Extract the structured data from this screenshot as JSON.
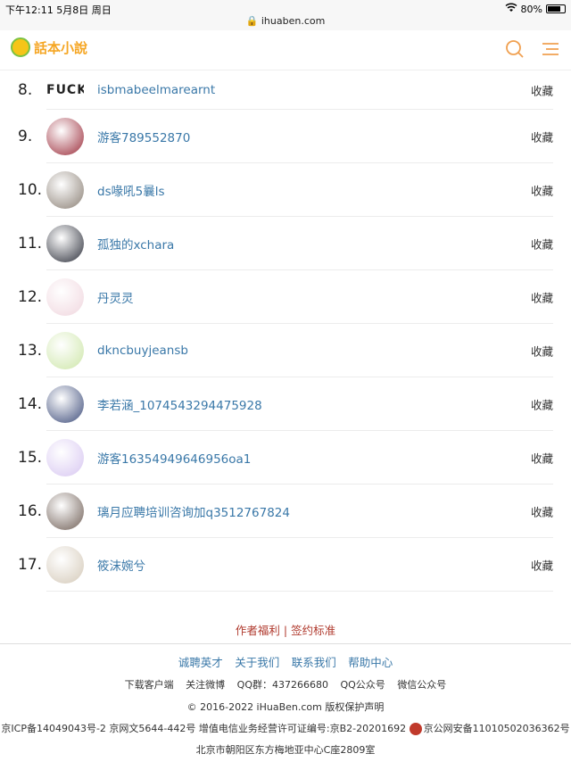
{
  "status": {
    "time": "下午12:11  5月8日 周日",
    "url": "ihuaben.com",
    "battery": "80%",
    "battery_level": 0.8
  },
  "header": {
    "logo": "話本小說"
  },
  "ranks": [
    {
      "num": "8.",
      "name": "isbmabeelmarearnt",
      "fav": "收藏",
      "avatar_text": "FUCK"
    },
    {
      "num": "9.",
      "name": "游客789552870",
      "fav": "收藏",
      "color": "#9b2c3a"
    },
    {
      "num": "10.",
      "name": "ds喙吼5曩ls",
      "fav": "收藏",
      "color": "#8a7f74"
    },
    {
      "num": "11.",
      "name": "孤独的xchara",
      "fav": "收藏",
      "color": "#2c2f3a"
    },
    {
      "num": "12.",
      "name": "丹灵灵",
      "fav": "收藏",
      "color": "#f0d6de"
    },
    {
      "num": "13.",
      "name": "dkncbuyjeansb",
      "fav": "收藏",
      "color": "#cde6a8"
    },
    {
      "num": "14.",
      "name": "李若涵_1074543294475928",
      "fav": "收藏",
      "color": "#3d4c7a"
    },
    {
      "num": "15.",
      "name": "游客16354949646956oa1",
      "fav": "收藏",
      "color": "#d7c6f1"
    },
    {
      "num": "16.",
      "name": "璃月应聘培训咨询加q3512767824",
      "fav": "收藏",
      "color": "#6f5e55"
    },
    {
      "num": "17.",
      "name": "筱沫婉兮",
      "fav": "收藏",
      "color": "#d4c9b8"
    }
  ],
  "author_links": "作者福利 | 签约标准",
  "footer": {
    "links": [
      "诚聘英才",
      "关于我们",
      "联系我们",
      "帮助中心"
    ],
    "row2": [
      "下载客户端",
      "关注微博",
      "QQ群：437266680",
      "QQ公众号",
      "微信公众号"
    ],
    "copyright": "© 2016-2022 iHuaBen.com 版权保护声明",
    "icp": "京ICP备14049043号-2 京网文5644-442号 增值电信业务经营许可证编号:京B2-20201692",
    "police": "京公网安备11010502036362号",
    "address": "北京市朝阳区东方梅地亚中心C座2809室"
  }
}
